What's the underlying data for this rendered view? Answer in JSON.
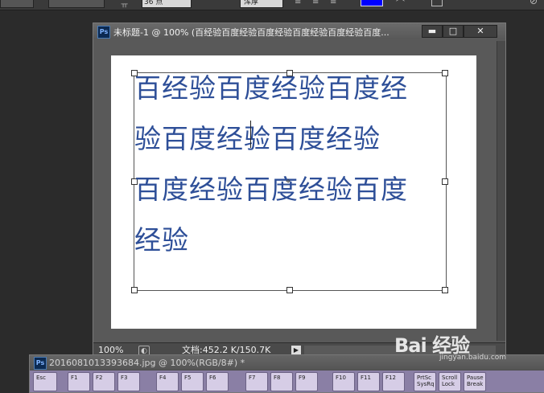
{
  "options_bar": {
    "font_size_value": "36 点",
    "antialias_value": "浑厚",
    "text_color": "#0000ff"
  },
  "document": {
    "title": "未标题-1 @ 100% (百经验百度经验百度经验百度经验百度经验百度...",
    "minimize_label": "▬",
    "restore_label": "□",
    "close_label": "✕",
    "text_lines": [
      "百经验百度经验百度经",
      "验百度经验百度经验",
      "百度经验百度经验百度",
      "经验"
    ],
    "text_color": "#2e4f98",
    "status": {
      "zoom": "100%",
      "doc_info": "文档:452.2 K/150.7K"
    }
  },
  "second_document": {
    "title": "20160810133936­84.jpg @ 100%(RGB/8#) *",
    "keys": [
      "Esc",
      "F1",
      "F2",
      "F3",
      "F4",
      "F5",
      "F6",
      "F7",
      "F8",
      "F9",
      "F10",
      "F11",
      "F12",
      "PrtSc SysRq",
      "Scroll Lock",
      "Pause Break"
    ]
  },
  "watermark": {
    "brand": "Bai 经验",
    "url": "jingyan.baidu.com"
  }
}
